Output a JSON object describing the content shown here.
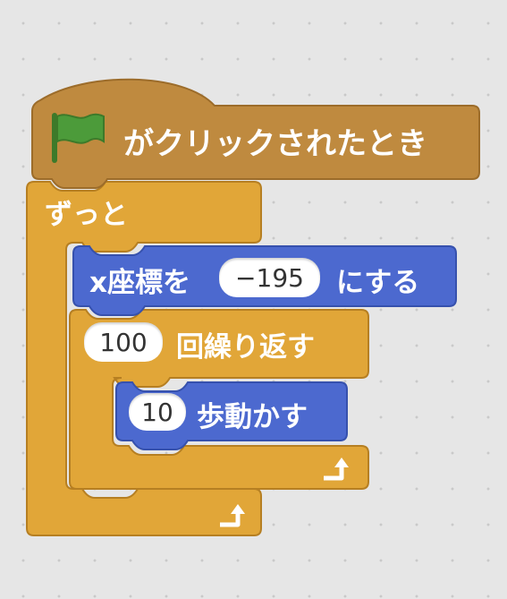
{
  "hat_block": {
    "label": "がクリックされたとき",
    "icon": "green-flag-icon",
    "color": "#bf8a3f"
  },
  "forever_block": {
    "label": "ずっと",
    "color": "#e1a638"
  },
  "set_x_block": {
    "label": "x座標を",
    "value": "−195",
    "suffix": "にする",
    "color": "#4c69cf"
  },
  "repeat_block": {
    "count": "100",
    "label": "回繰り返す",
    "color": "#e1a638"
  },
  "move_block": {
    "steps": "10",
    "label": "歩動かす",
    "color": "#4c69cf"
  },
  "loop_arrow_icon": "loop-arrow-icon"
}
